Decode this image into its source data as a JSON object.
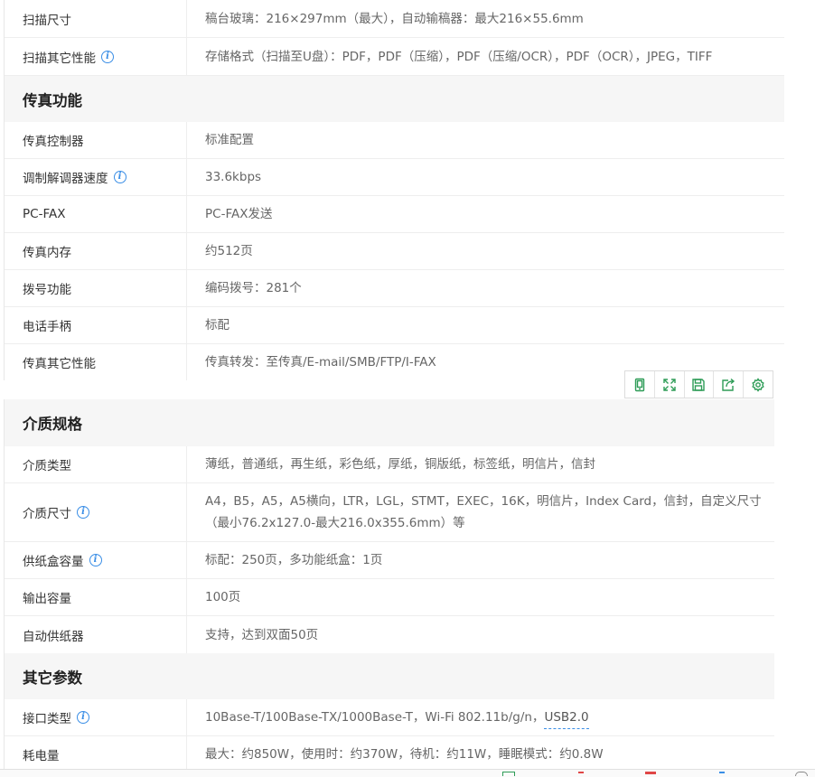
{
  "sections": [
    {
      "id": "scan",
      "rows": [
        {
          "label": "扫描尺寸",
          "value": "稿台玻璃：216×297mm（最大），自动输稿器：最大216×55.6mm",
          "info": false
        },
        {
          "label": "扫描其它性能",
          "value": "存储格式（扫描至U盘）：PDF，PDF（压缩），PDF（压缩/OCR），PDF（OCR），JPEG，TIFF",
          "info": true
        }
      ]
    },
    {
      "id": "fax",
      "title": "传真功能",
      "rows": [
        {
          "label": "传真控制器",
          "value": "标准配置",
          "info": false
        },
        {
          "label": "调制解调器速度",
          "value": "33.6kbps",
          "info": true
        },
        {
          "label": "PC-FAX",
          "value": "PC-FAX发送",
          "info": false
        },
        {
          "label": "传真内存",
          "value": "约512页",
          "info": false
        },
        {
          "label": "拨号功能",
          "value": "编码拨号：281个",
          "info": false
        },
        {
          "label": "电话手柄",
          "value": "标配",
          "info": false
        },
        {
          "label": "传真其它性能",
          "value": "传真转发：至传真/E-mail/SMB/FTP/I-FAX",
          "info": false
        }
      ]
    },
    {
      "id": "media",
      "title": "介质规格",
      "rows": [
        {
          "label": "介质类型",
          "value": "薄纸，普通纸，再生纸，彩色纸，厚纸，铜版纸，标签纸，明信片，信封",
          "info": false
        },
        {
          "label": "介质尺寸",
          "value": "A4，B5，A5，A5横向，LTR，LGL，STMT，EXEC，16K，明信片，Index Card，信封，自定义尺寸（最小76.2x127.0-最大216.0x355.6mm）等",
          "info": true
        },
        {
          "label": "供纸盒容量",
          "value": "标配：250页，多功能纸盒：1页",
          "info": true
        },
        {
          "label": "输出容量",
          "value": "100页",
          "info": false
        },
        {
          "label": "自动供纸器",
          "value": "支持，达到双面50页",
          "info": false
        }
      ]
    },
    {
      "id": "other",
      "title": "其它参数",
      "rows": [
        {
          "label": "接口类型",
          "value": "10Base-T/100Base-TX/1000Base-T，Wi-Fi 802.11b/g/n，",
          "link": "USB2.0",
          "info": true
        },
        {
          "label": "耗电量",
          "value": "最大：约850W，使用时：约370W，待机：约11W，睡眠模式：约0.8W",
          "info": false
        }
      ]
    }
  ],
  "toolbar": {
    "icons": [
      "phone-icon",
      "fullscreen-icon",
      "save-icon",
      "share-icon",
      "settings-icon"
    ],
    "color": "#2e9c57"
  },
  "info_icon_glyph": "i"
}
